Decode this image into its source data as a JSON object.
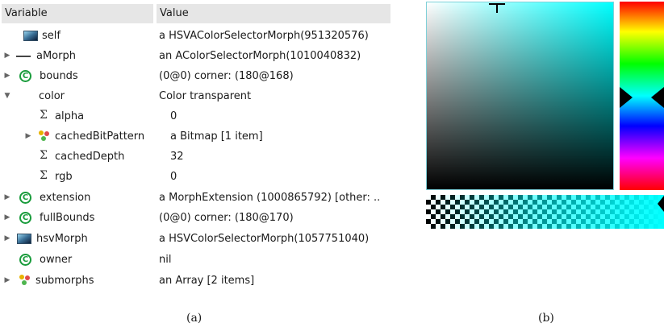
{
  "inspector": {
    "header": {
      "variable": "Variable",
      "value": "Value"
    },
    "rows": [
      {
        "name": "self",
        "value": "a HSVAColorSelectorMorph(951320576)",
        "icon": "morph-icon",
        "expand": ""
      },
      {
        "name": "aMorph",
        "value": "an AColorSelectorMorph(1010040832)",
        "icon": "line-morph-icon",
        "expand": "▶"
      },
      {
        "name": "bounds",
        "value": "(0@0) corner: (180@168)",
        "icon": "class-icon",
        "expand": "▶"
      },
      {
        "name": "color",
        "value": "Color transparent",
        "icon": "",
        "expand": "▼"
      },
      {
        "name": "alpha",
        "value": "0",
        "icon": "sigma-icon",
        "expand": ""
      },
      {
        "name": "cachedBitPattern",
        "value": "a Bitmap [1 item]",
        "icon": "collection-icon",
        "expand": "▶"
      },
      {
        "name": "cachedDepth",
        "value": "32",
        "icon": "sigma-icon",
        "expand": ""
      },
      {
        "name": "rgb",
        "value": "0",
        "icon": "sigma-icon",
        "expand": ""
      },
      {
        "name": "extension",
        "value": "a MorphExtension (1000865792) [other: ..",
        "icon": "class-icon",
        "expand": "▶"
      },
      {
        "name": "fullBounds",
        "value": "(0@0) corner: (180@170)",
        "icon": "class-icon",
        "expand": "▶"
      },
      {
        "name": "hsvMorph",
        "value": "a HSVColorSelectorMorph(1057751040)",
        "icon": "morph-icon",
        "expand": "▶"
      },
      {
        "name": "owner",
        "value": "nil",
        "icon": "class-icon",
        "expand": ""
      },
      {
        "name": "submorphs",
        "value": "an Array [2 items]",
        "icon": "collection-icon",
        "expand": "▶"
      }
    ],
    "class_icon_glyph": "C",
    "sigma_glyph": "Σ"
  },
  "captions": {
    "a": "(a)",
    "b": "(b)"
  },
  "colors": {
    "class_icon": "#1a9c3c",
    "header_bg": "#e6e6e6",
    "selector_color": "#00ffff"
  }
}
